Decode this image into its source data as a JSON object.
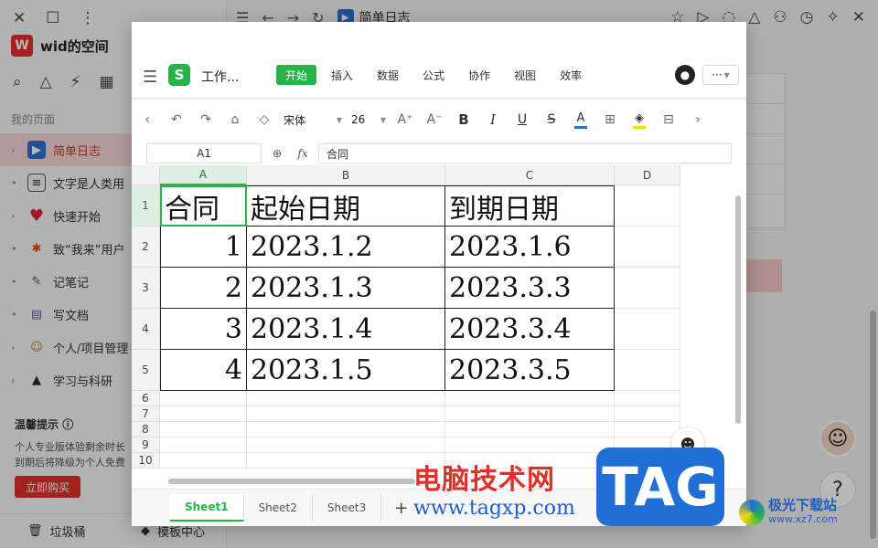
{
  "app": {
    "space_initial": "W",
    "space_name": "wid的空间",
    "section_label": "我的页面",
    "nav_items": [
      {
        "label": "简单日志",
        "icon": "doc-blue-icon",
        "active": true
      },
      {
        "label": "文字是人类用",
        "icon": "text-doc-icon"
      },
      {
        "label": "快速开始",
        "icon": "heart-icon"
      },
      {
        "label": "致“我来”用户",
        "icon": "party-icon"
      },
      {
        "label": "记笔记",
        "icon": "pen-icon"
      },
      {
        "label": "写文档",
        "icon": "document-icon"
      },
      {
        "label": "个人/项目管理",
        "icon": "person-icon"
      },
      {
        "label": "学习与科研",
        "icon": "graduation-cap-icon"
      }
    ],
    "tip": {
      "title": "温馨提示",
      "line1": "个人专业版体验剩余时长",
      "line2": "到期后将降级为个人免费",
      "buy_label": "立即购买"
    },
    "bottom": {
      "trash_label": "垃圾桶",
      "template_label": "模板中心"
    },
    "top_doc_title": "简单日志"
  },
  "sheet_app": {
    "file_title": "工作...",
    "tabs": [
      "开始",
      "插入",
      "数据",
      "公式",
      "协作",
      "视图",
      "效率"
    ],
    "more_label": "···",
    "toolbar": {
      "font_name": "宋体",
      "font_size": "26"
    },
    "name_box": "A1",
    "formula_value": "合同",
    "columns": [
      "A",
      "B",
      "C",
      "D"
    ],
    "rows": [
      "1",
      "2",
      "3",
      "4",
      "5",
      "6",
      "7",
      "8",
      "9",
      "10"
    ],
    "cells": [
      [
        "合同",
        "起始日期",
        "到期日期"
      ],
      [
        "1",
        "2023.1.2",
        "2023.1.6"
      ],
      [
        "2",
        "2023.1.3",
        "2023.3.3"
      ],
      [
        "3",
        "2023.1.4",
        "2023.3.4"
      ],
      [
        "4",
        "2023.1.5",
        "2023.3.5"
      ]
    ],
    "sheets": [
      "Sheet1",
      "Sheet2",
      "Sheet3"
    ],
    "active_sheet": "Sheet1"
  },
  "watermark": {
    "cn_text": "电脑技术网",
    "url": "www.tagxp.com",
    "tag": "TAG",
    "site_name": "极光下载站",
    "site_url": "www.xz7.com"
  },
  "colors": {
    "brand_red": "#e0302c",
    "sheet_green": "#27b24a",
    "watermark_blue": "#1f6fd6"
  }
}
